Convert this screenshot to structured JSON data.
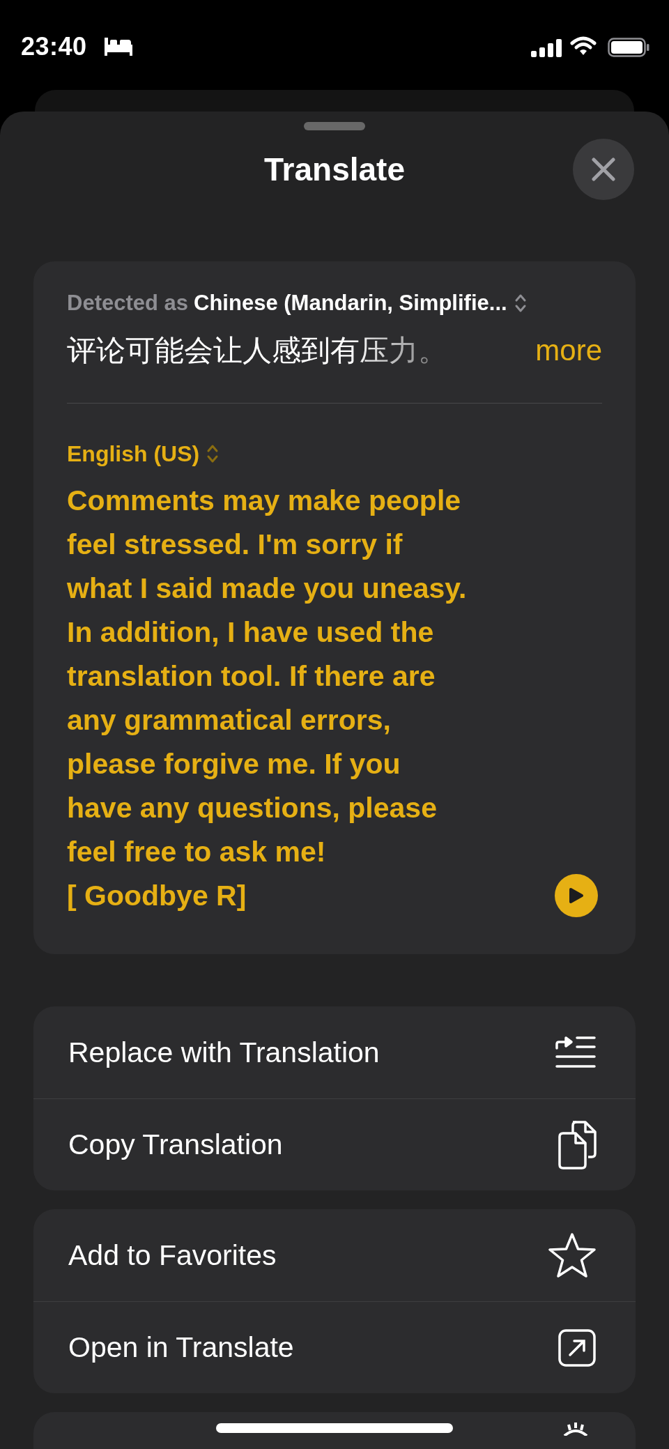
{
  "status_bar": {
    "time": "23:40"
  },
  "sheet": {
    "title": "Translate"
  },
  "source": {
    "detected_label": "Detected as",
    "language": "Chinese (Mandarin, Simplifie...",
    "text": "评论可能会让人感到有压力。",
    "more": "more"
  },
  "target": {
    "language": "English (US)",
    "text": "Comments may make people\nfeel stressed. I'm sorry if\nwhat I said made you uneasy.\nIn addition, I have used the\ntranslation tool. If there are\nany grammatical errors,\nplease forgive me. If you\nhave any questions, please\nfeel free to ask me!\n[ Goodbye R]"
  },
  "action_groups": [
    {
      "items": [
        {
          "label": "Replace with Translation",
          "kind": "replace"
        },
        {
          "label": "Copy Translation",
          "kind": "copy"
        }
      ]
    },
    {
      "items": [
        {
          "label": "Add to Favorites",
          "kind": "star"
        },
        {
          "label": "Open in Translate",
          "kind": "open"
        }
      ]
    },
    {
      "items": [
        {
          "kind": "gear"
        }
      ]
    }
  ]
}
